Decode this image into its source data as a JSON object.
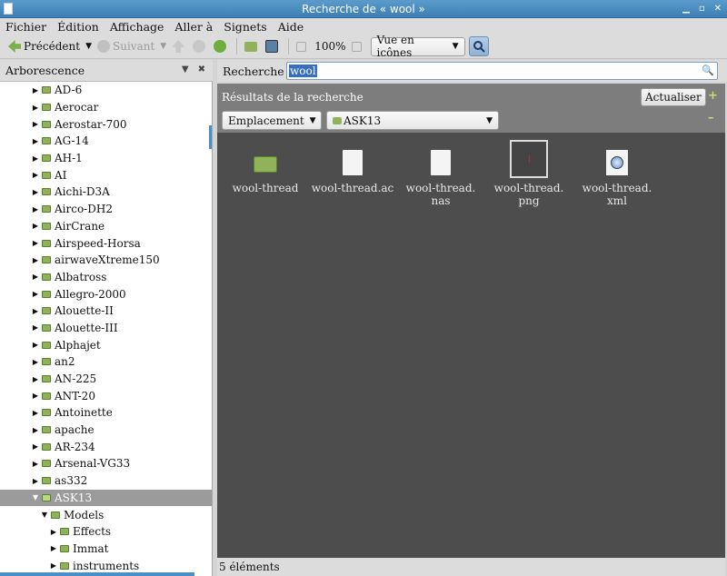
{
  "window": {
    "title": "Recherche de « wool »"
  },
  "menu": [
    "Fichier",
    "Édition",
    "Affichage",
    "Aller à",
    "Signets",
    "Aide"
  ],
  "toolbar": {
    "back_label": "Précédent",
    "forward_label": "Suivant",
    "zoom": "100%",
    "view_mode": "Vue en icônes"
  },
  "sidebar": {
    "title": "Arborescence",
    "items": [
      {
        "label": "AD-6",
        "level": 0,
        "expanded": false
      },
      {
        "label": "Aerocar",
        "level": 0,
        "expanded": false
      },
      {
        "label": "Aerostar-700",
        "level": 0,
        "expanded": false
      },
      {
        "label": "AG-14",
        "level": 0,
        "expanded": false
      },
      {
        "label": "AH-1",
        "level": 0,
        "expanded": false
      },
      {
        "label": "AI",
        "level": 0,
        "expanded": false
      },
      {
        "label": "Aichi-D3A",
        "level": 0,
        "expanded": false
      },
      {
        "label": "Airco-DH2",
        "level": 0,
        "expanded": false
      },
      {
        "label": "AirCrane",
        "level": 0,
        "expanded": false
      },
      {
        "label": "Airspeed-Horsa",
        "level": 0,
        "expanded": false
      },
      {
        "label": "airwaveXtreme150",
        "level": 0,
        "expanded": false
      },
      {
        "label": "Albatross",
        "level": 0,
        "expanded": false
      },
      {
        "label": "Allegro-2000",
        "level": 0,
        "expanded": false
      },
      {
        "label": "Alouette-II",
        "level": 0,
        "expanded": false
      },
      {
        "label": "Alouette-III",
        "level": 0,
        "expanded": false
      },
      {
        "label": "Alphajet",
        "level": 0,
        "expanded": false
      },
      {
        "label": "an2",
        "level": 0,
        "expanded": false
      },
      {
        "label": "AN-225",
        "level": 0,
        "expanded": false
      },
      {
        "label": "ANT-20",
        "level": 0,
        "expanded": false
      },
      {
        "label": "Antoinette",
        "level": 0,
        "expanded": false
      },
      {
        "label": "apache",
        "level": 0,
        "expanded": false
      },
      {
        "label": "AR-234",
        "level": 0,
        "expanded": false
      },
      {
        "label": "Arsenal-VG33",
        "level": 0,
        "expanded": false
      },
      {
        "label": "as332",
        "level": 0,
        "expanded": false
      },
      {
        "label": "ASK13",
        "level": 0,
        "expanded": true,
        "selected": true
      },
      {
        "label": "Models",
        "level": 1,
        "expanded": true
      },
      {
        "label": "Effects",
        "level": 2,
        "expanded": false
      },
      {
        "label": "Immat",
        "level": 2,
        "expanded": false
      },
      {
        "label": "instruments",
        "level": 2,
        "expanded": false
      }
    ]
  },
  "search": {
    "label": "Recherche :",
    "value": "wool"
  },
  "results": {
    "title": "Résultats de la recherche",
    "refresh_label": "Actualiser",
    "criterion": "Emplacement",
    "location": "ASK13"
  },
  "files": [
    {
      "name": "wool-thread",
      "kind": "folder-icon"
    },
    {
      "name": "wool-thread.ac",
      "kind": "document-icon"
    },
    {
      "name": "wool-thread.\nnas",
      "kind": "document-icon"
    },
    {
      "name": "wool-thread.\npng",
      "kind": "image-icon"
    },
    {
      "name": "wool-thread.\nxml",
      "kind": "xml-icon"
    }
  ],
  "status": "5 éléments"
}
